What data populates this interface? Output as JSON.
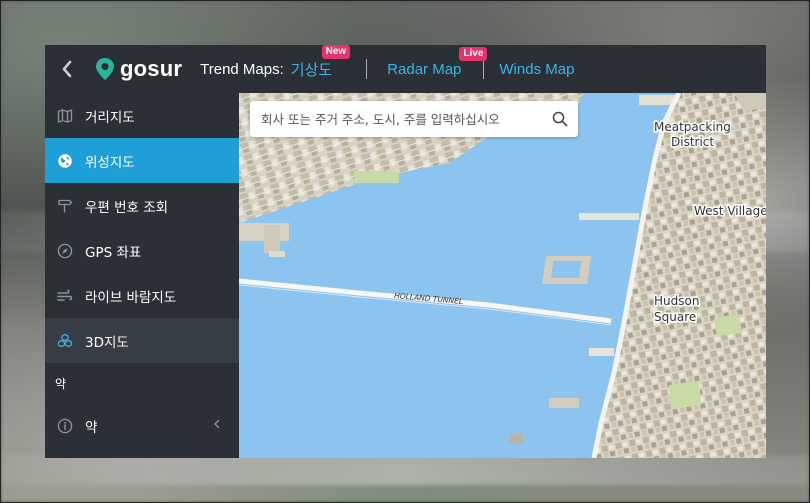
{
  "header": {
    "logo_text": "gosur",
    "trend_label": "Trend Maps:",
    "links": [
      {
        "label": "기상도",
        "badge": "New"
      },
      {
        "label": "Radar Map",
        "badge": "Live"
      },
      {
        "label": "Winds Map"
      }
    ]
  },
  "sidebar": {
    "items": [
      {
        "label": "거리지도",
        "icon": "map-icon"
      },
      {
        "label": "위성지도",
        "icon": "globe-icon",
        "active": true
      },
      {
        "label": "우편 번호 조회",
        "icon": "signpost-icon"
      },
      {
        "label": "GPS 좌표",
        "icon": "compass-icon"
      },
      {
        "label": "라이브 바람지도",
        "icon": "wind-icon"
      },
      {
        "label": "3D지도",
        "icon": "cubes-icon",
        "highlighted": true
      }
    ],
    "section_label": "약",
    "about_item": {
      "label": "약",
      "icon": "info-icon"
    }
  },
  "search": {
    "placeholder": "회사 또는 주거 주소, 도시, 주를 입력하십시오"
  },
  "map_labels": {
    "meatpacking": [
      "Meatpacking",
      "District"
    ],
    "west_village": "West Village",
    "hudson": [
      "Hudson",
      "Square"
    ],
    "tunnel": "HOLLAND TUNNEL"
  },
  "colors": {
    "accent": "#1ea0d6",
    "link": "#38b6e8",
    "badge": "#e5336d",
    "panel": "#2b3036",
    "water": "#8cc4ef"
  }
}
